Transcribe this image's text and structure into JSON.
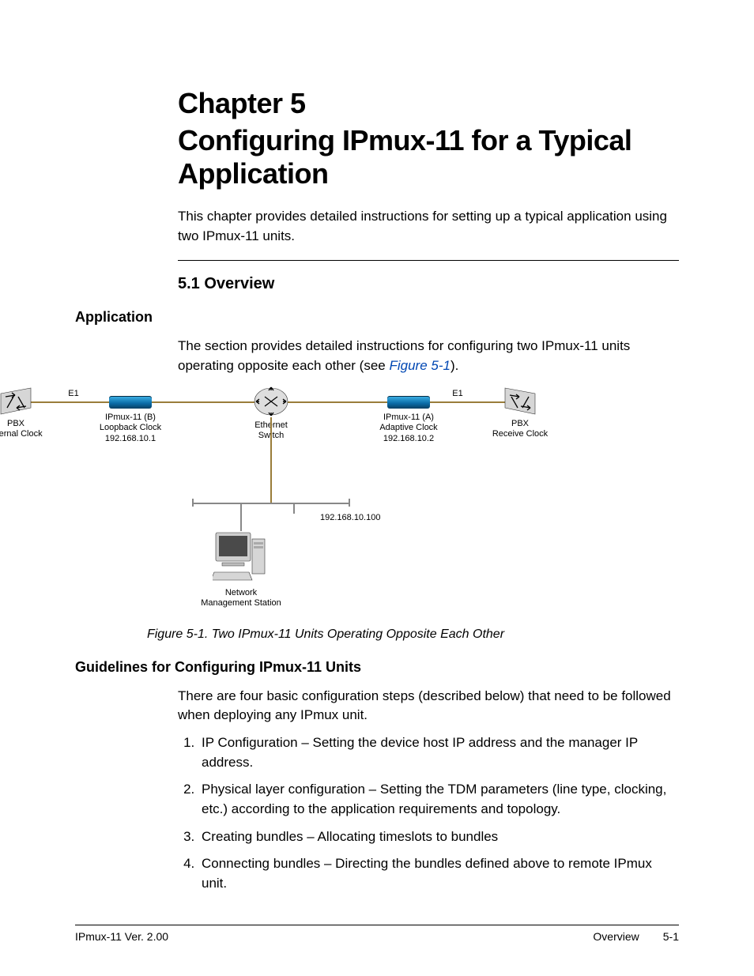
{
  "chapter_label": "Chapter 5",
  "chapter_title": "Configuring IPmux-11 for a Typical Application",
  "intro": "This chapter provides detailed instructions for setting up a typical application using two IPmux-11 units.",
  "section_num_title": "5.1  Overview",
  "sub_application": "Application",
  "app_text_before": "The section provides detailed instructions for configuring two IPmux-11 units operating opposite each other (see ",
  "app_figref": "Figure 5-1",
  "app_text_after": ").",
  "diagram": {
    "e1_left": "E1",
    "e1_right": "E1",
    "pbx_left": "PBX\nInternal Clock",
    "ipmux_b": "IPmux-11 (B)\nLoopback Clock\n192.168.10.1",
    "eth_switch": "Ethernet\nSwitch",
    "ipmux_a": "IPmux-11 (A)\nAdaptive Clock\n192.168.10.2",
    "pbx_right": "PBX\nReceive Clock",
    "nms_ip": "192.168.10.100",
    "nms": "Network\nManagement Station"
  },
  "figure_caption": "Figure 5-1.  Two IPmux-11 Units Operating Opposite Each Other",
  "sub_guidelines": "Guidelines for Configuring IPmux-11 Units",
  "guidelines_intro": "There are four basic configuration steps (described below) that need to be followed when deploying any IPmux unit.",
  "steps": {
    "s1": "IP Configuration – Setting the device host IP address and the manager IP address.",
    "s2": "Physical layer configuration – Setting the TDM parameters (line type, clocking, etc.) according to the application requirements and topology.",
    "s3": "Creating bundles – Allocating timeslots to bundles",
    "s4": "Connecting bundles – Directing the bundles defined above to remote IPmux unit."
  },
  "footer": {
    "left": "IPmux-11 Ver. 2.00",
    "center": "Overview",
    "page": "5-1"
  }
}
